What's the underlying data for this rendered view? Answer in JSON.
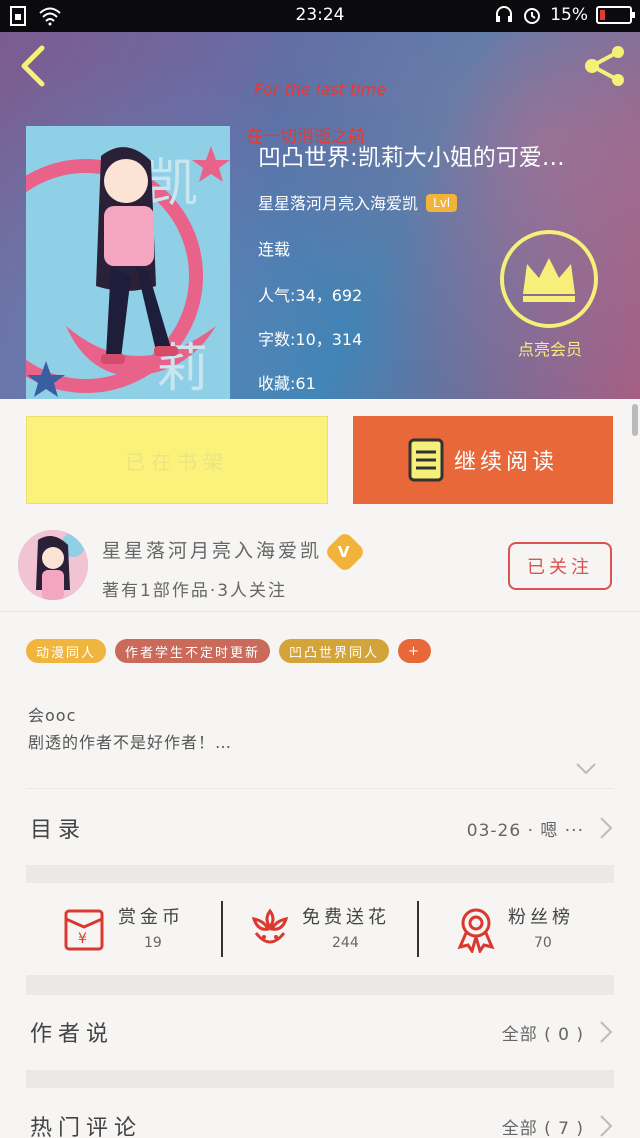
{
  "status_bar": {
    "time": "23:24",
    "battery": "15%"
  },
  "hero": {
    "deco_line1": "For the last time",
    "deco_line2": "在一切消逝之前",
    "book_title": "凹凸世界:凯莉大小姐的可爱…",
    "author": "星星落河月亮入海爱凯",
    "level": "Lvl",
    "status": "连载",
    "popularity": "人气:34，692",
    "word_count": "字数:10，314",
    "favorites": "收藏:61",
    "vip_label": "点亮会员"
  },
  "actions": {
    "shelf_label": "已在书架",
    "read_label": "继续阅读"
  },
  "author_row": {
    "name": "星星落河月亮入海爱凯",
    "badge": "V",
    "stats": "著有1部作品·3人关注",
    "follow_label": "已关注"
  },
  "tags": [
    {
      "label": "动漫同人",
      "color": "#f0b53e"
    },
    {
      "label": "作者学生不定时更新",
      "color": "#c96a5a"
    },
    {
      "label": "凹凸世界同人",
      "color": "#d3a43a"
    },
    {
      "label": "+",
      "color": "#e8683a"
    }
  ],
  "description": {
    "line1": "会ooc",
    "line2": "剧透的作者不是好作者！…"
  },
  "catalog": {
    "title": "目录",
    "latest": "03-26 · 嗯 ···"
  },
  "rewards": [
    {
      "name": "赏金币",
      "count": "19",
      "icon": "red-envelope-icon"
    },
    {
      "name": "免费送花",
      "count": "244",
      "icon": "flower-icon"
    },
    {
      "name": "粉丝榜",
      "count": "70",
      "icon": "ribbon-medal-icon"
    }
  ],
  "author_says": {
    "title": "作者说",
    "right": "全部 ( 0 )"
  },
  "hot_comments": {
    "title": "热门评论",
    "right": "全部 ( 7 )"
  }
}
